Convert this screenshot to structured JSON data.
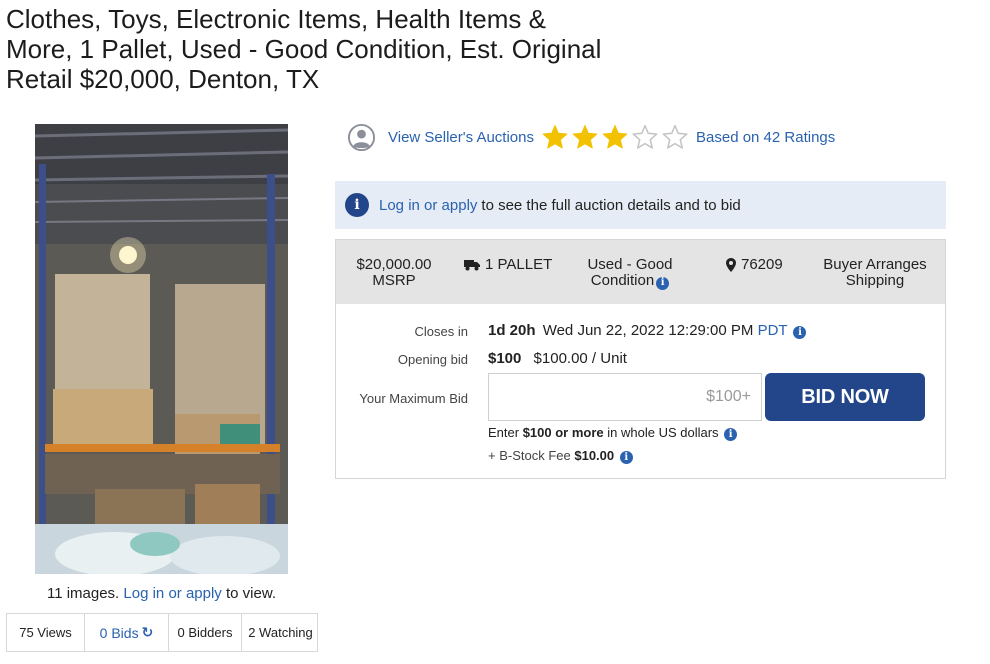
{
  "listing": {
    "title": "Clothes, Toys, Electronic Items, Health Items & More, 1 Pallet, Used - Good Condition, Est. Original Retail $20,000, Denton, TX"
  },
  "gallery": {
    "note_count": "11 images.",
    "note_link": "Log in or apply",
    "note_suffix": "to view."
  },
  "stats": {
    "views": "75 Views",
    "bids": "0 Bids",
    "bidders": "0 Bidders",
    "watching": "2 Watching"
  },
  "seller": {
    "link_label": "View Seller's Auctions",
    "rating": 3,
    "rating_max": 5,
    "ratings_label": "Based on 42 Ratings",
    "star_color": "#f2c200"
  },
  "banner": {
    "link": "Log in or apply",
    "text": "to see the full auction details and to bid"
  },
  "summary": {
    "msrp_value": "$20,000.00",
    "msrp_label": "MSRP",
    "quantity": "1 PALLET",
    "condition": "Used - Good Condition",
    "zip": "76209",
    "shipping": "Buyer Arranges Shipping"
  },
  "auction": {
    "closes_label": "Closes in",
    "closes_remaining": "1d 20h",
    "closes_date": "Wed Jun 22, 2022 12:29:00 PM",
    "closes_tz": "PDT",
    "opening_label": "Opening bid",
    "opening_bid": "$100",
    "opening_unit": "$100.00 / Unit",
    "maxbid_label": "Your Maximum Bid",
    "maxbid_placeholder": "$100+",
    "bid_button": "BID NOW",
    "hint_enter": "Enter",
    "hint_amount": "$100 or more",
    "hint_suffix": "in whole US dollars",
    "fee_label": "+ B-Stock Fee",
    "fee_amount": "$10.00"
  },
  "colors": {
    "brand_navy": "#23468a",
    "link_blue": "#2a62b0",
    "banner_bg": "#e6ecf5",
    "summary_bg": "#e4e4e4"
  }
}
